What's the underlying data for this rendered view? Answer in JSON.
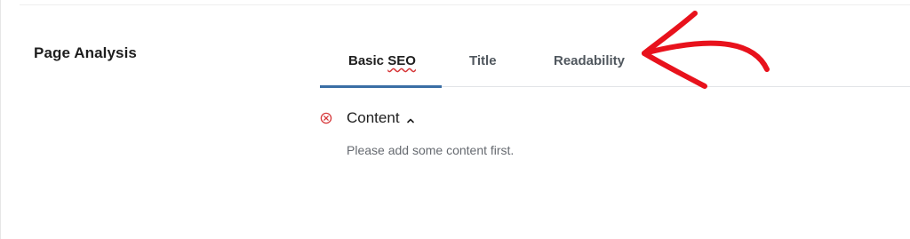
{
  "section": {
    "title": "Page Analysis"
  },
  "tabs": [
    {
      "label_main": "Basic",
      "label_flagged": "SEO",
      "active": true
    },
    {
      "label": "Title",
      "active": false
    },
    {
      "label": "Readability",
      "active": false
    }
  ],
  "content_check": {
    "label": "Content",
    "status_icon": "error-circle-icon",
    "toggle_icon": "chevron-up-icon",
    "message": "Please add some content first."
  },
  "colors": {
    "error": "#d63638",
    "active_tab": "#3a6ea5",
    "annotation": "#e8121c"
  }
}
